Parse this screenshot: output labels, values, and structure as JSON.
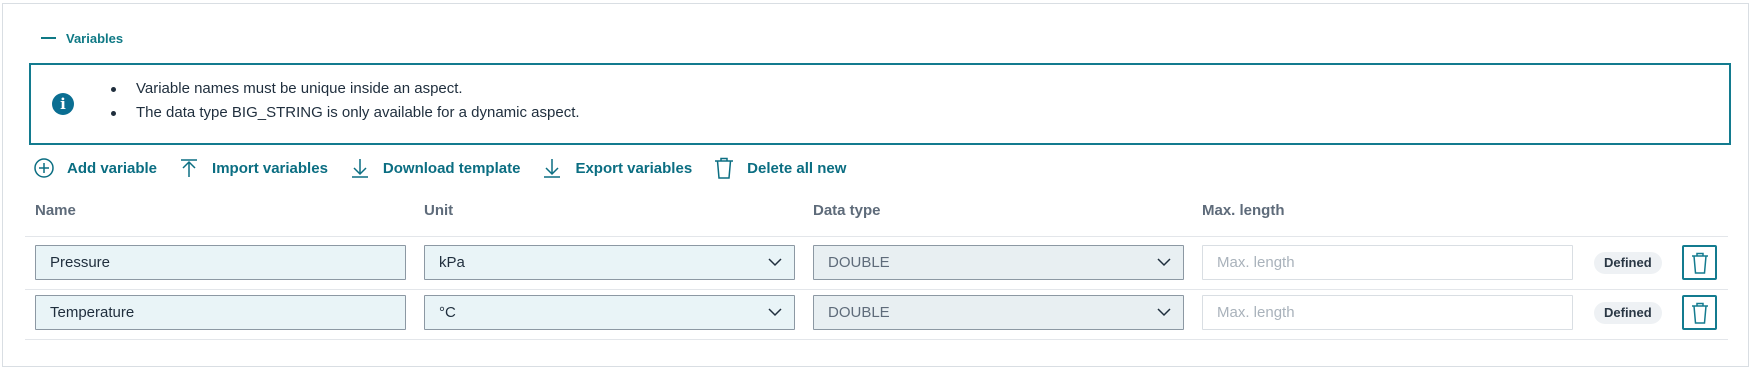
{
  "section": {
    "label": "Variables"
  },
  "info": {
    "lines": [
      "Variable names must be unique inside an aspect.",
      "The data type BIG_STRING is only available for a dynamic aspect."
    ]
  },
  "toolbar": {
    "add_variable": "Add variable",
    "import_variables": "Import variables",
    "download_template": "Download template",
    "export_variables": "Export variables",
    "delete_all_new": "Delete all new"
  },
  "columns": {
    "name": "Name",
    "unit": "Unit",
    "data_type": "Data type",
    "max_length": "Max. length"
  },
  "rows": [
    {
      "name": "Pressure",
      "unit": "kPa",
      "data_type": "DOUBLE",
      "max_length": "",
      "max_length_placeholder": "Max. length",
      "status": "Defined"
    },
    {
      "name": "Temperature",
      "unit": "°C",
      "data_type": "DOUBLE",
      "max_length": "",
      "max_length_placeholder": "Max. length",
      "status": "Defined"
    }
  ],
  "colors": {
    "accent": "#0f7985",
    "info_border": "#137b8f",
    "input_bg": "#e9f4f7"
  },
  "icons": {
    "section": "collapse-dash-icon",
    "info": "info-icon",
    "add": "plus-circle-icon",
    "import": "upload-arrow-icon",
    "download": "download-arrow-icon",
    "export": "download-arrow-icon",
    "delete": "trash-icon",
    "select": "chevron-down-icon"
  }
}
